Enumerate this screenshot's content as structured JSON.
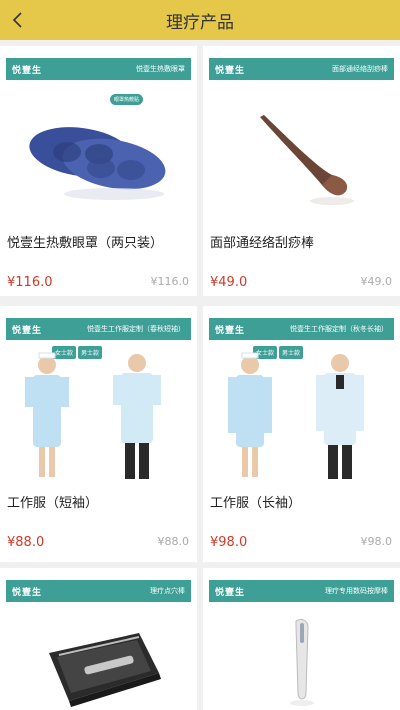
{
  "header": {
    "title": "理疗产品",
    "back_icon": "chevron-left-icon"
  },
  "colors": {
    "header_bg": "#e5c74a",
    "banner_bg": "#3e9f97",
    "price": "#d03a2a"
  },
  "products": [
    {
      "banner_logo": "悦壹生",
      "banner_text": "悦壹生热敷眼罩",
      "name": "悦壹生热敷眼罩（两只装）",
      "price": "¥116.0",
      "original_price": "¥116.0",
      "image": "eye-mask-image",
      "badge": "眼罩热敷贴"
    },
    {
      "banner_logo": "悦壹生",
      "banner_text": "面部通经络刮痧棒",
      "name": "面部通经络刮痧棒",
      "price": "¥49.0",
      "original_price": "¥49.0",
      "image": "gua-sha-image"
    },
    {
      "banner_logo": "悦壹生",
      "banner_text": "悦壹生工作服定制（春秋短袖）",
      "name": "工作服（短袖）",
      "price": "¥88.0",
      "original_price": "¥88.0",
      "image": "short-sleeve-uniform-image",
      "tags": [
        "女士款",
        "男士款"
      ]
    },
    {
      "banner_logo": "悦壹生",
      "banner_text": "悦壹生工作服定制（秋冬长袖）",
      "name": "工作服（长袖）",
      "price": "¥98.0",
      "original_price": "¥98.0",
      "image": "long-sleeve-uniform-image",
      "tags": [
        "女士款",
        "男士款"
      ]
    },
    {
      "banner_logo": "悦壹生",
      "banner_text": "理疗点穴棒",
      "image": "massage-pen-case-image"
    },
    {
      "banner_logo": "悦壹生",
      "banner_text": "理疗专用数码按摩棒",
      "image": "beauty-device-image"
    }
  ]
}
